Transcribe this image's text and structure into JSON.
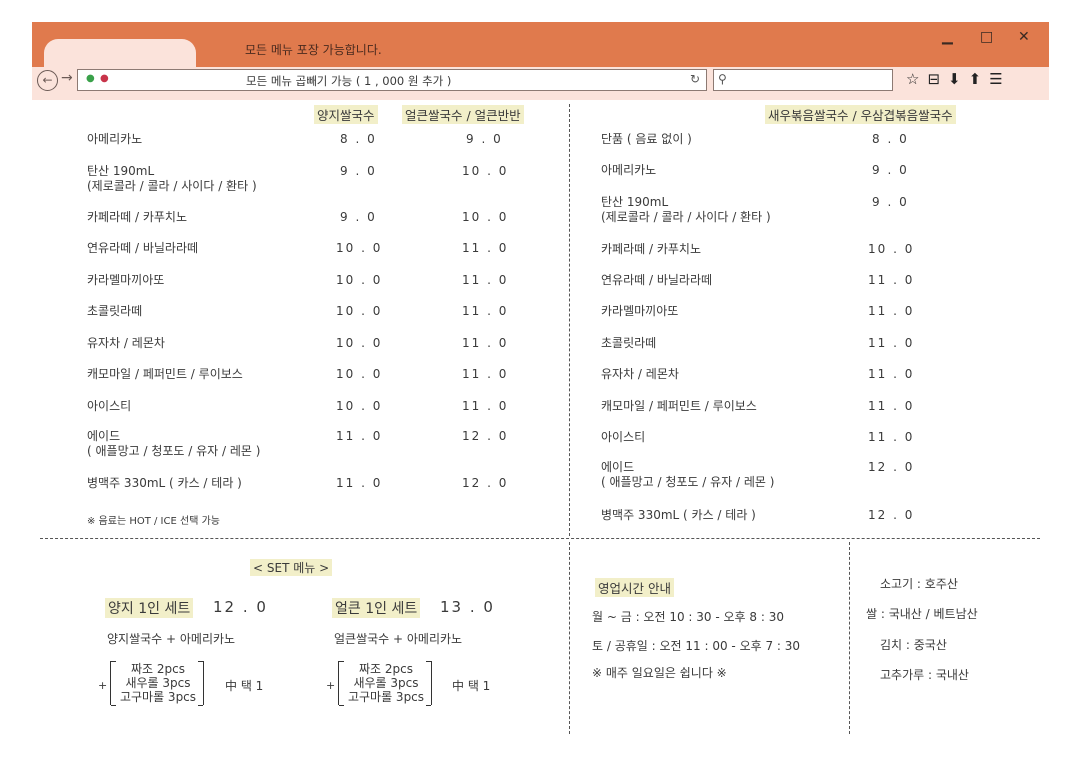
{
  "window": {
    "title": "모든 메뉴 포장 가능합니다.",
    "controls": {
      "minimize": "▁",
      "maximize": "□",
      "close": "✕"
    }
  },
  "navbar": {
    "back_icon": "back-arrow-icon",
    "forward_icon": "forward-arrow-icon",
    "url_text": "모든 메뉴 곱빼기 가능 ( 1 , 000 원 추가 )",
    "reload_icon": "reload-icon",
    "search_value": "",
    "tool_icons": [
      "star-icon",
      "bookmarks-icon",
      "download-icon",
      "home-icon",
      "menu-icon"
    ]
  },
  "left_menu": {
    "headers": [
      "양지쌀국수",
      "얼큰쌀국수 / 얼큰반반"
    ],
    "items": [
      {
        "name": "아메리카노",
        "p1": "8 . 0",
        "p2": "9 . 0"
      },
      {
        "name": "탄산 190mL",
        "sub": "(제로콜라 / 콜라 / 사이다 / 환타 )",
        "p1": "9 . 0",
        "p2": "10 . 0"
      },
      {
        "name": "카페라떼 / 카푸치노",
        "p1": "9 . 0",
        "p2": "10 . 0"
      },
      {
        "name": "연유라떼 / 바닐라라떼",
        "p1": "10 . 0",
        "p2": "11 . 0"
      },
      {
        "name": "카라멜마끼아또",
        "p1": "10 . 0",
        "p2": "11 . 0"
      },
      {
        "name": "초콜릿라떼",
        "p1": "10 . 0",
        "p2": "11 . 0"
      },
      {
        "name": "유자차 / 레몬차",
        "p1": "10 . 0",
        "p2": "11 . 0"
      },
      {
        "name": "캐모마일 / 페퍼민트 / 루이보스",
        "p1": "10 . 0",
        "p2": "11 . 0"
      },
      {
        "name": "아이스티",
        "p1": "10 . 0",
        "p2": "11 . 0"
      },
      {
        "name": "에이드",
        "sub": "( 애플망고 / 청포도 / 유자 / 레몬 )",
        "p1": "11 . 0",
        "p2": "12 . 0"
      },
      {
        "name": "병맥주 330mL ( 카스 / 테라 )",
        "p1": "11 . 0",
        "p2": "12 . 0"
      }
    ],
    "note": "※ 음료는 HOT / ICE 선택 가능"
  },
  "right_menu": {
    "header": "새우볶음쌀국수 / 우삼겹볶음쌀국수",
    "items": [
      {
        "name": "단품 ( 음료 없이 )",
        "p": "8 . 0"
      },
      {
        "name": "아메리카노",
        "p": "9 . 0"
      },
      {
        "name": "탄산 190mL",
        "sub": "(제로콜라 / 콜라 / 사이다 / 환타 )",
        "p": "9 . 0"
      },
      {
        "name": "카페라떼 / 카푸치노",
        "p": "10 . 0"
      },
      {
        "name": "연유라떼 / 바닐라라떼",
        "p": "11 . 0"
      },
      {
        "name": "카라멜마끼아또",
        "p": "11 . 0"
      },
      {
        "name": "초콜릿라떼",
        "p": "11 . 0"
      },
      {
        "name": "유자차 / 레몬차",
        "p": "11 . 0"
      },
      {
        "name": "캐모마일 / 페퍼민트 / 루이보스",
        "p": "11 . 0"
      },
      {
        "name": "아이스티",
        "p": "11 . 0"
      },
      {
        "name": "에이드",
        "sub": "( 애플망고 / 청포도 / 유자 / 레몬 )",
        "p": "12 . 0"
      },
      {
        "name": "병맥주 330mL ( 카스 / 테라 )",
        "p": "12 . 0"
      }
    ]
  },
  "set_menu": {
    "title": "< SET 메뉴 >",
    "sets": [
      {
        "name": "양지 1인 세트",
        "price": "12 . 0",
        "desc": "양지쌀국수 + 아메리카노",
        "plus": "+",
        "choices": [
          "짜조 2pcs",
          "새우롤 3pcs",
          "고구마롤 3pcs"
        ],
        "pick": "中 택 1"
      },
      {
        "name": "얼큰 1인 세트",
        "price": "13 . 0",
        "desc": "얼큰쌀국수 + 아메리카노",
        "plus": "+",
        "choices": [
          "짜조 2pcs",
          "새우롤 3pcs",
          "고구마롤 3pcs"
        ],
        "pick": "中 택 1"
      }
    ]
  },
  "hours": {
    "title": "영업시간 안내",
    "lines": [
      "월 ~ 금 : 오전 10 : 30 - 오후 8 : 30",
      "토 / 공휴일 : 오전 11 : 00 - 오후 7 : 30",
      "※ 매주 일요일은 쉽니다 ※"
    ]
  },
  "origin": {
    "lines": [
      "소고기 : 호주산",
      "쌀 : 국내산 / 베트남산",
      "김치 : 중국산",
      "고추가루 : 국내산"
    ]
  },
  "colors": {
    "titlebar": "#e07a4d",
    "navbar": "#fbe3db",
    "highlight": "#f2efc9"
  }
}
